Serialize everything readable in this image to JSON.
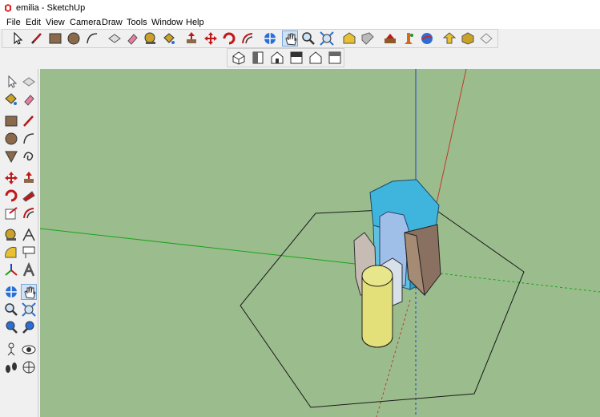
{
  "window": {
    "title": "emilia - SketchUp"
  },
  "menu": [
    "File",
    "Edit",
    "View",
    "Camera",
    "Draw",
    "Tools",
    "Window",
    "Help"
  ],
  "toolbar": {
    "tools": [
      "select-icon",
      "line-icon",
      "rectangle-icon",
      "circle-icon",
      "arc-icon",
      "make-component-icon",
      "eraser-icon",
      "tape-measure-icon",
      "paint-bucket-icon",
      "push-pull-icon",
      "move-icon",
      "rotate-icon",
      "offset-icon",
      "orbit-icon",
      "pan-icon",
      "zoom-icon",
      "zoom-extents-icon",
      "warehouse-icon",
      "extension-icon",
      "layer-icon",
      "location-icon",
      "geo-icon",
      "upload-icon",
      "component-icon",
      "section-icon"
    ]
  },
  "views_toolbar": [
    "iso-view-icon",
    "top-view-icon",
    "front-view-icon",
    "right-view-icon",
    "back-view-icon",
    "left-view-icon"
  ],
  "colors": {
    "viewport_bg": "#9bbd8d",
    "axis_red": "#c0392b",
    "axis_green": "#1aa31a",
    "axis_blue": "#1f3fd6",
    "cylinder": "#e3e07a",
    "prism_top": "#3fb5dd"
  }
}
